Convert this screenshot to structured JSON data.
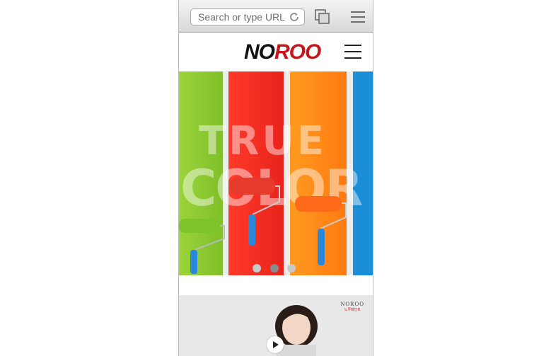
{
  "browser": {
    "url_placeholder": "Search or type URL",
    "icons": [
      "reload-icon",
      "tabs-icon",
      "menu-icon"
    ]
  },
  "site": {
    "logo_text_dark": "NO",
    "logo_text_red": "ROO",
    "menu_icon": "hamburger-icon"
  },
  "hero": {
    "overlay_line1": "TRUE",
    "overlay_line2": "COLOR",
    "carousel": {
      "count": 3,
      "active_index": 1
    }
  },
  "video": {
    "brand_logo": "NOROO",
    "brand_sub": "노루페인트",
    "play_icon": "play-icon"
  },
  "colors": {
    "green": "#8dc63f",
    "red": "#ed2f26",
    "orange": "#ff8c1a",
    "blue": "#1a8fd8",
    "brand_red": "#c4161c"
  }
}
